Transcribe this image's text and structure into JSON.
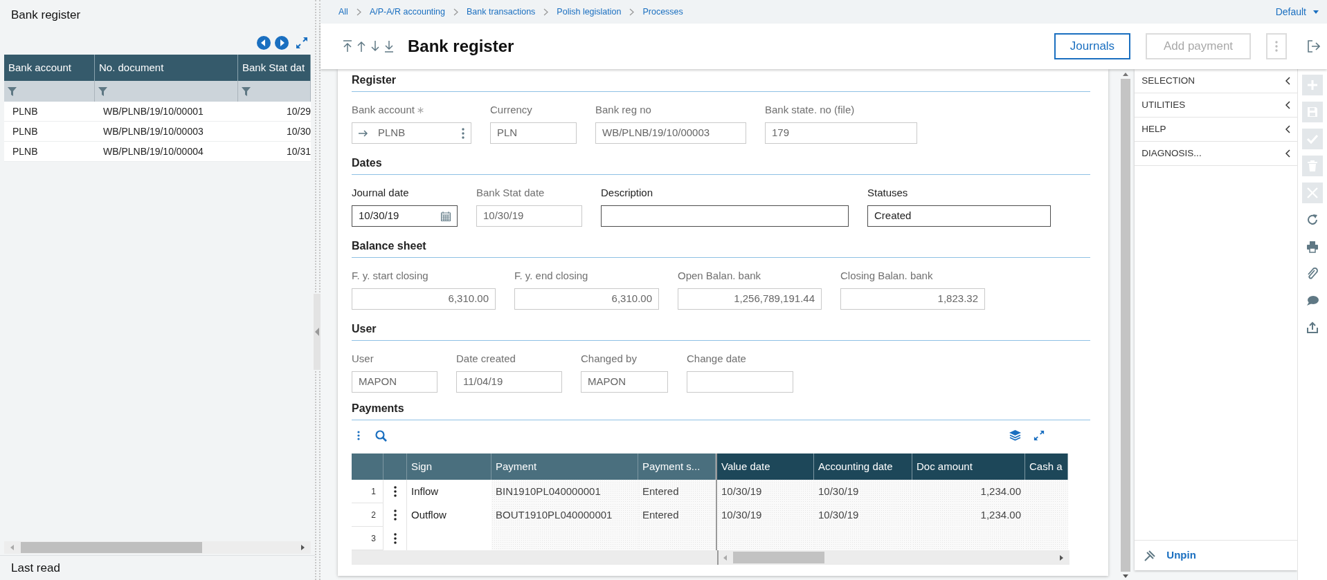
{
  "left_panel": {
    "title": "Bank register",
    "table": {
      "columns": [
        "Bank account",
        "No. document",
        "Bank Stat dat"
      ],
      "rows": [
        [
          "PLNB",
          "WB/PLNB/19/10/00001",
          "10/29"
        ],
        [
          "PLNB",
          "WB/PLNB/19/10/00003",
          "10/30"
        ],
        [
          "PLNB",
          "WB/PLNB/19/10/00004",
          "10/31"
        ]
      ]
    },
    "footer": "Last read"
  },
  "breadcrumb": [
    "All",
    "A/P-A/R accounting",
    "Bank transactions",
    "Polish legislation",
    "Processes"
  ],
  "view_selector": "Default",
  "header": {
    "title": "Bank register",
    "buttons": [
      {
        "label": "Journals",
        "disabled": false
      },
      {
        "label": "Add payment",
        "disabled": true
      }
    ]
  },
  "sections": [
    {
      "title": "Register",
      "fields": [
        {
          "label": "Bank account",
          "value": "PLNB",
          "kind": "lookup",
          "required": true,
          "disabled": true
        },
        {
          "label": "Currency",
          "value": "PLN",
          "kind": "text",
          "required": false,
          "disabled": true
        },
        {
          "label": "Bank reg no",
          "value": "WB/PLNB/19/10/00003",
          "kind": "text",
          "required": false,
          "disabled": true
        },
        {
          "label": "Bank state. no (file)",
          "value": "179",
          "kind": "text",
          "required": false,
          "disabled": true
        }
      ]
    },
    {
      "title": "Dates",
      "fields": [
        {
          "label": "Journal date",
          "value": "10/30/19",
          "kind": "date",
          "required": false,
          "disabled": false
        },
        {
          "label": "Bank Stat date",
          "value": "10/30/19",
          "kind": "text",
          "required": false,
          "disabled": true
        },
        {
          "label": "Description",
          "kind": "text",
          "required": false,
          "disabled": false
        },
        {
          "label": "Statuses",
          "value": "Created",
          "kind": "text",
          "required": false,
          "disabled": false
        }
      ]
    },
    {
      "title": "Balance sheet",
      "fields": [
        {
          "label": "F. y. start closing",
          "value": "6,310.00",
          "kind": "number",
          "required": false,
          "disabled": true
        },
        {
          "label": "F. y. end closing",
          "value": "6,310.00",
          "kind": "number",
          "required": false,
          "disabled": true
        },
        {
          "label": "Open Balan. bank",
          "value": "1,256,789,191.44",
          "kind": "number",
          "required": false,
          "disabled": true
        },
        {
          "label": "Closing Balan. bank",
          "value": "1,823.32",
          "kind": "number",
          "required": false,
          "disabled": true
        }
      ]
    },
    {
      "title": "User",
      "fields": [
        {
          "label": "User",
          "value": "MAPON",
          "kind": "text",
          "required": false,
          "disabled": true
        },
        {
          "label": "Date created",
          "value": "11/04/19",
          "kind": "text",
          "required": false,
          "disabled": true
        },
        {
          "label": "Changed by",
          "value": "MAPON",
          "kind": "text",
          "required": false,
          "disabled": true
        },
        {
          "label": "Change date",
          "kind": "text",
          "required": false,
          "disabled": true
        }
      ]
    }
  ],
  "payments": {
    "title": "Payments",
    "columns": [
      {
        "label": "Sign",
        "frozen": true
      },
      {
        "label": "Payment",
        "frozen": true
      },
      {
        "label": "Payment s...",
        "frozen": true
      },
      {
        "label": "Value date",
        "frozen": false
      },
      {
        "label": "Accounting date",
        "frozen": false
      },
      {
        "label": "Doc amount",
        "frozen": false
      },
      {
        "label": "Cash a",
        "frozen": false
      }
    ],
    "rows": [
      {
        "number": "1",
        "cells": [
          "Inflow",
          "BIN1910PL040000001",
          "Entered",
          "10/30/19",
          "10/30/19",
          "1,234.00",
          ""
        ]
      },
      {
        "number": "2",
        "cells": [
          "Outflow",
          "BOUT1910PL040000001",
          "Entered",
          "10/30/19",
          "10/30/19",
          "1,234.00",
          ""
        ]
      },
      {
        "number": "3",
        "cells": [
          "",
          "",
          "",
          "",
          "",
          "",
          ""
        ]
      }
    ]
  },
  "side_panel": {
    "sections": [
      "SELECTION",
      "UTILITIES",
      "HELP",
      "DIAGNOSIS..."
    ],
    "unpin": "Unpin"
  },
  "toolbar": [
    {
      "kind": "add",
      "disabled": true
    },
    {
      "kind": "save",
      "disabled": true
    },
    {
      "kind": "validate",
      "disabled": true
    },
    {
      "kind": "delete",
      "disabled": true
    },
    {
      "kind": "cancel",
      "disabled": true
    },
    {
      "kind": "refresh",
      "disabled": false
    },
    {
      "kind": "print",
      "disabled": false
    },
    {
      "kind": "attach",
      "disabled": false
    },
    {
      "kind": "comment",
      "disabled": false
    },
    {
      "kind": "export",
      "disabled": false
    }
  ]
}
